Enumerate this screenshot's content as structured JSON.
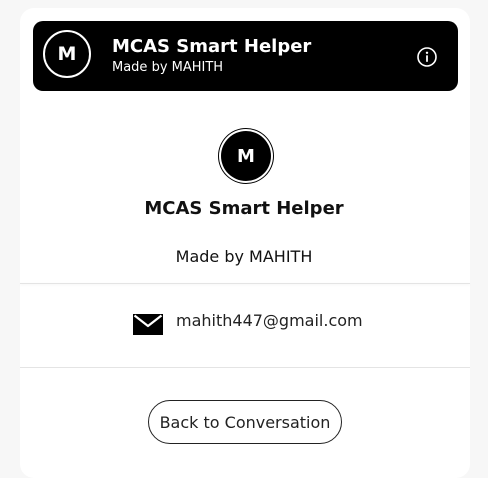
{
  "header": {
    "avatar_letter": "M",
    "title": "MCAS Smart Helper",
    "subtitle": "Made by MAHITH",
    "info_icon": "info-circle-icon"
  },
  "profile": {
    "avatar_letter": "M",
    "name": "MCAS Smart Helper",
    "credit": "Made by MAHITH"
  },
  "contact": {
    "icon": "envelope-icon",
    "email": "mahith447@gmail.com"
  },
  "actions": {
    "back_label": "Back to Conversation"
  },
  "colors": {
    "header_bg": "#000000",
    "panel_bg": "#ffffff",
    "page_bg": "#f7f7f7",
    "text": "#111111"
  }
}
